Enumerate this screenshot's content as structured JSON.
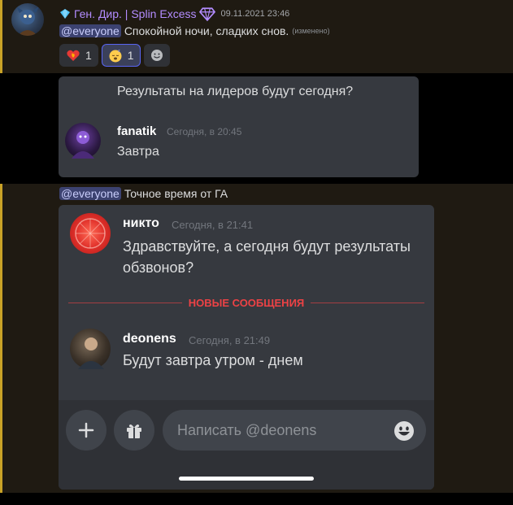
{
  "top_message": {
    "username": "Ген. Дир. | Splin Excess",
    "timestamp": "09.11.2021 23:46",
    "mention": "@everyone",
    "text": "Спокойной ночи, сладких снов.",
    "edited": "(изменено)",
    "reactions": [
      {
        "emoji": "fire-heart-icon",
        "count": "1",
        "active": false
      },
      {
        "emoji": "sleeping-face-icon",
        "count": "1",
        "active": true
      }
    ],
    "add_reaction_icon": "add-reaction-icon"
  },
  "reply_card": {
    "question": "Результаты на лидеров будут сегодня?",
    "author": "fanatik",
    "time": "Сегодня, в 20:45",
    "text": "Завтра"
  },
  "bottom_message": {
    "mention": "@everyone",
    "text": "Точное время от ГА"
  },
  "screenshot_card": {
    "messages": [
      {
        "author": "никто",
        "time": "Сегодня, в 21:41",
        "text": "Здравствуйте, а сегодня будут результаты обзвонов?"
      },
      {
        "author": "deonens",
        "time": "Сегодня, в 21:49",
        "text": "Будут завтра утром - днем"
      }
    ],
    "new_messages_label": "НОВЫЕ СООБЩЕНИЯ",
    "input_placeholder": "Написать @deonens"
  },
  "colors": {
    "accent_highlight": "#c9a227",
    "username_role": "#b38cff",
    "mention_bg": "#3c4270",
    "new_divider": "#ed4245",
    "card_bg": "#36393f"
  }
}
